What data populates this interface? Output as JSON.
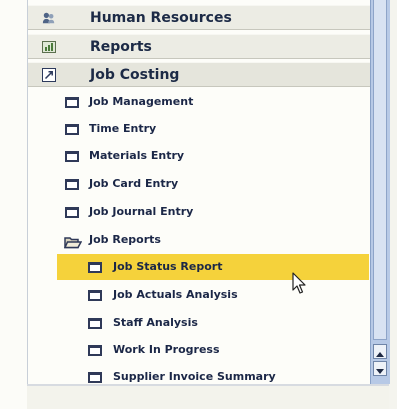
{
  "navigation": {
    "categories": [
      {
        "label": "Human Resources",
        "icon": "people-icon"
      },
      {
        "label": "Reports",
        "icon": "chart-icon"
      },
      {
        "label": "Job Costing",
        "icon": "job-costing-icon"
      }
    ],
    "job_costing_items": [
      {
        "label": "Job Management"
      },
      {
        "label": "Time Entry"
      },
      {
        "label": "Materials Entry"
      },
      {
        "label": "Job Card Entry"
      },
      {
        "label": "Job Journal Entry"
      },
      {
        "label": "Job Reports",
        "icon": "open-folder-icon"
      }
    ],
    "job_reports_items": [
      {
        "label": "Job Status Report",
        "selected": true
      },
      {
        "label": "Job Actuals Analysis"
      },
      {
        "label": "Staff Analysis"
      },
      {
        "label": "Work In Progress"
      },
      {
        "label": "Supplier Invoice Summary"
      }
    ]
  },
  "colors": {
    "selection": "#f5d23b",
    "text": "#1b2747",
    "scrollbar": "#b7c9e6"
  },
  "icons": {
    "scroll_up": "scroll-up-arrow-icon",
    "scroll_down": "scroll-down-arrow-icon",
    "cursor": "mouse-pointer-icon"
  }
}
